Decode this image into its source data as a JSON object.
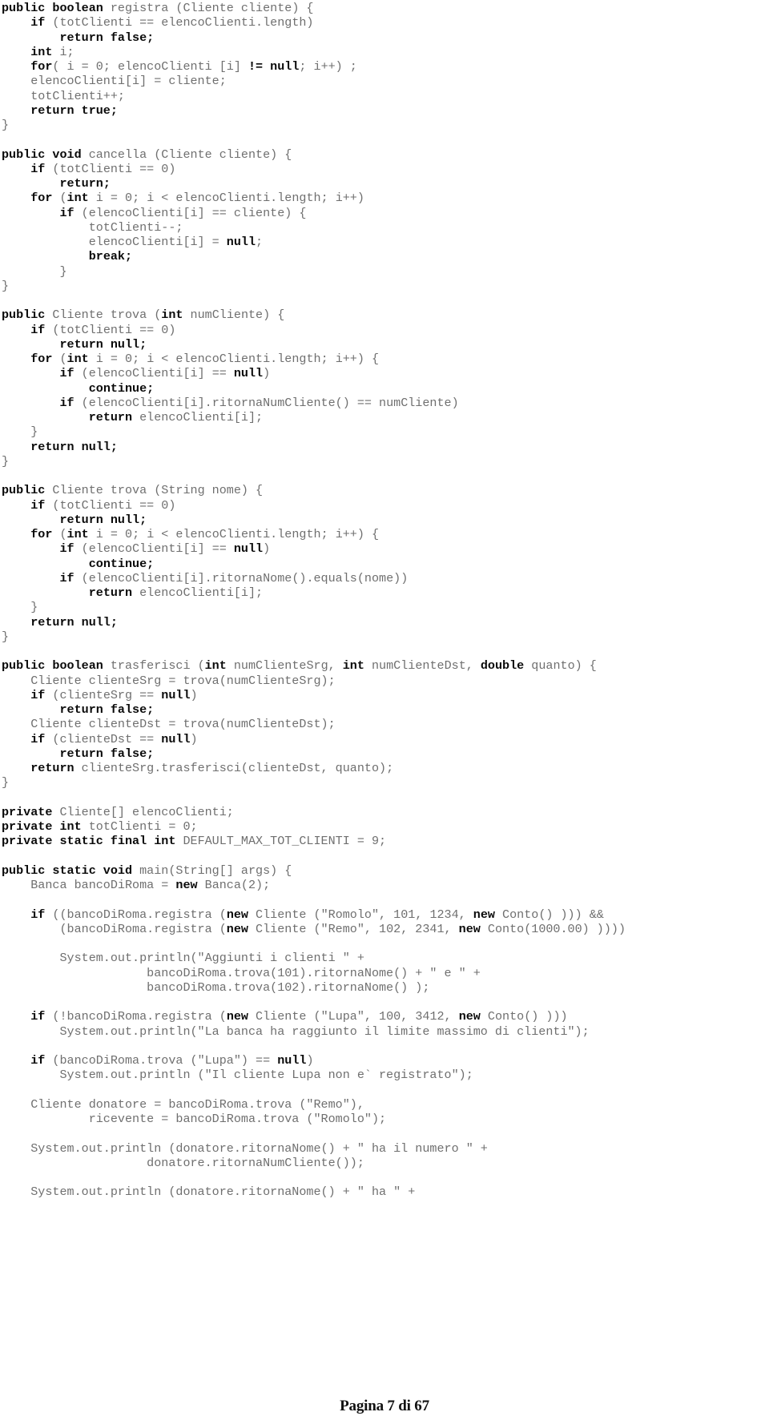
{
  "document": {
    "type": "source-code-listing",
    "language": "Java",
    "footer": {
      "label": "Pagina 7 di 67",
      "page_number": "7",
      "total_pages": "67"
    },
    "colors": {
      "keyword": "#0a0a0a",
      "identifier": "#6f6f6f",
      "background": "#ffffff",
      "footer": "#111111"
    }
  },
  "code": {
    "lines": [
      [
        {
          "t": "public boolean",
          "k": true
        },
        {
          "t": " registra (Cliente cliente) {",
          "k": false
        }
      ],
      [
        {
          "t": "    ",
          "k": false
        },
        {
          "t": "if",
          "k": true
        },
        {
          "t": " (totClienti == elencoClienti.length)",
          "k": false
        }
      ],
      [
        {
          "t": "        ",
          "k": false
        },
        {
          "t": "return false;",
          "k": true
        }
      ],
      [
        {
          "t": "    ",
          "k": false
        },
        {
          "t": "int",
          "k": true
        },
        {
          "t": " i;",
          "k": false
        }
      ],
      [
        {
          "t": "    ",
          "k": false
        },
        {
          "t": "for",
          "k": true
        },
        {
          "t": "( i = 0; elencoClienti [i] ",
          "k": false
        },
        {
          "t": "!= null",
          "k": true
        },
        {
          "t": "; i++) ;",
          "k": false
        }
      ],
      [
        {
          "t": "    elencoClienti[i] = cliente;",
          "k": false
        }
      ],
      [
        {
          "t": "    totClienti++;",
          "k": false
        }
      ],
      [
        {
          "t": "    ",
          "k": false
        },
        {
          "t": "return true;",
          "k": true
        }
      ],
      [
        {
          "t": "}",
          "k": false
        }
      ],
      [
        {
          "t": "",
          "k": false
        }
      ],
      [
        {
          "t": "public void",
          "k": true
        },
        {
          "t": " cancella (Cliente cliente) {",
          "k": false
        }
      ],
      [
        {
          "t": "    ",
          "k": false
        },
        {
          "t": "if",
          "k": true
        },
        {
          "t": " (totClienti == 0)",
          "k": false
        }
      ],
      [
        {
          "t": "        ",
          "k": false
        },
        {
          "t": "return;",
          "k": true
        }
      ],
      [
        {
          "t": "    ",
          "k": false
        },
        {
          "t": "for",
          "k": true
        },
        {
          "t": " (",
          "k": false
        },
        {
          "t": "int",
          "k": true
        },
        {
          "t": " i = 0; i < elencoClienti.length; i++)",
          "k": false
        }
      ],
      [
        {
          "t": "        ",
          "k": false
        },
        {
          "t": "if",
          "k": true
        },
        {
          "t": " (elencoClienti[i] == cliente) {",
          "k": false
        }
      ],
      [
        {
          "t": "            totClienti--;",
          "k": false
        }
      ],
      [
        {
          "t": "            elencoClienti[i] = ",
          "k": false
        },
        {
          "t": "null",
          "k": true
        },
        {
          "t": ";",
          "k": false
        }
      ],
      [
        {
          "t": "            ",
          "k": false
        },
        {
          "t": "break;",
          "k": true
        }
      ],
      [
        {
          "t": "        }",
          "k": false
        }
      ],
      [
        {
          "t": "}",
          "k": false
        }
      ],
      [
        {
          "t": "",
          "k": false
        }
      ],
      [
        {
          "t": "public",
          "k": true
        },
        {
          "t": " Cliente trova (",
          "k": false
        },
        {
          "t": "int",
          "k": true
        },
        {
          "t": " numCliente) {",
          "k": false
        }
      ],
      [
        {
          "t": "    ",
          "k": false
        },
        {
          "t": "if",
          "k": true
        },
        {
          "t": " (totClienti == 0)",
          "k": false
        }
      ],
      [
        {
          "t": "        ",
          "k": false
        },
        {
          "t": "return null;",
          "k": true
        }
      ],
      [
        {
          "t": "    ",
          "k": false
        },
        {
          "t": "for",
          "k": true
        },
        {
          "t": " (",
          "k": false
        },
        {
          "t": "int",
          "k": true
        },
        {
          "t": " i = 0; i < elencoClienti.length; i++) {",
          "k": false
        }
      ],
      [
        {
          "t": "        ",
          "k": false
        },
        {
          "t": "if",
          "k": true
        },
        {
          "t": " (elencoClienti[i] == ",
          "k": false
        },
        {
          "t": "null",
          "k": true
        },
        {
          "t": ")",
          "k": false
        }
      ],
      [
        {
          "t": "            ",
          "k": false
        },
        {
          "t": "continue;",
          "k": true
        }
      ],
      [
        {
          "t": "        ",
          "k": false
        },
        {
          "t": "if",
          "k": true
        },
        {
          "t": " (elencoClienti[i].ritornaNumCliente() == numCliente)",
          "k": false
        }
      ],
      [
        {
          "t": "            ",
          "k": false
        },
        {
          "t": "return",
          "k": true
        },
        {
          "t": " elencoClienti[i];",
          "k": false
        }
      ],
      [
        {
          "t": "    }",
          "k": false
        }
      ],
      [
        {
          "t": "    ",
          "k": false
        },
        {
          "t": "return null;",
          "k": true
        }
      ],
      [
        {
          "t": "}",
          "k": false
        }
      ],
      [
        {
          "t": "",
          "k": false
        }
      ],
      [
        {
          "t": "public",
          "k": true
        },
        {
          "t": " Cliente trova (String nome) {",
          "k": false
        }
      ],
      [
        {
          "t": "    ",
          "k": false
        },
        {
          "t": "if",
          "k": true
        },
        {
          "t": " (totClienti == 0)",
          "k": false
        }
      ],
      [
        {
          "t": "        ",
          "k": false
        },
        {
          "t": "return null;",
          "k": true
        }
      ],
      [
        {
          "t": "    ",
          "k": false
        },
        {
          "t": "for",
          "k": true
        },
        {
          "t": " (",
          "k": false
        },
        {
          "t": "int",
          "k": true
        },
        {
          "t": " i = 0; i < elencoClienti.length; i++) {",
          "k": false
        }
      ],
      [
        {
          "t": "        ",
          "k": false
        },
        {
          "t": "if",
          "k": true
        },
        {
          "t": " (elencoClienti[i] == ",
          "k": false
        },
        {
          "t": "null",
          "k": true
        },
        {
          "t": ")",
          "k": false
        }
      ],
      [
        {
          "t": "            ",
          "k": false
        },
        {
          "t": "continue;",
          "k": true
        }
      ],
      [
        {
          "t": "        ",
          "k": false
        },
        {
          "t": "if",
          "k": true
        },
        {
          "t": " (elencoClienti[i].ritornaNome().equals(nome))",
          "k": false
        }
      ],
      [
        {
          "t": "            ",
          "k": false
        },
        {
          "t": "return",
          "k": true
        },
        {
          "t": " elencoClienti[i];",
          "k": false
        }
      ],
      [
        {
          "t": "    }",
          "k": false
        }
      ],
      [
        {
          "t": "    ",
          "k": false
        },
        {
          "t": "return null;",
          "k": true
        }
      ],
      [
        {
          "t": "}",
          "k": false
        }
      ],
      [
        {
          "t": "",
          "k": false
        }
      ],
      [
        {
          "t": "public boolean",
          "k": true
        },
        {
          "t": " trasferisci (",
          "k": false
        },
        {
          "t": "int",
          "k": true
        },
        {
          "t": " numClienteSrg, ",
          "k": false
        },
        {
          "t": "int",
          "k": true
        },
        {
          "t": " numClienteDst, ",
          "k": false
        },
        {
          "t": "double",
          "k": true
        },
        {
          "t": " quanto) {",
          "k": false
        }
      ],
      [
        {
          "t": "    Cliente clienteSrg = trova(numClienteSrg);",
          "k": false
        }
      ],
      [
        {
          "t": "    ",
          "k": false
        },
        {
          "t": "if",
          "k": true
        },
        {
          "t": " (clienteSrg == ",
          "k": false
        },
        {
          "t": "null",
          "k": true
        },
        {
          "t": ")",
          "k": false
        }
      ],
      [
        {
          "t": "        ",
          "k": false
        },
        {
          "t": "return false;",
          "k": true
        }
      ],
      [
        {
          "t": "    Cliente clienteDst = trova(numClienteDst);",
          "k": false
        }
      ],
      [
        {
          "t": "    ",
          "k": false
        },
        {
          "t": "if",
          "k": true
        },
        {
          "t": " (clienteDst == ",
          "k": false
        },
        {
          "t": "null",
          "k": true
        },
        {
          "t": ")",
          "k": false
        }
      ],
      [
        {
          "t": "        ",
          "k": false
        },
        {
          "t": "return false;",
          "k": true
        }
      ],
      [
        {
          "t": "    ",
          "k": false
        },
        {
          "t": "return",
          "k": true
        },
        {
          "t": " clienteSrg.trasferisci(clienteDst, quanto);",
          "k": false
        }
      ],
      [
        {
          "t": "}",
          "k": false
        }
      ],
      [
        {
          "t": "",
          "k": false
        }
      ],
      [
        {
          "t": "private",
          "k": true
        },
        {
          "t": " Cliente[] elencoClienti;",
          "k": false
        }
      ],
      [
        {
          "t": "private int",
          "k": true
        },
        {
          "t": " totClienti = 0;",
          "k": false
        }
      ],
      [
        {
          "t": "private static final int",
          "k": true
        },
        {
          "t": " DEFAULT_MAX_TOT_CLIENTI = 9;",
          "k": false
        }
      ],
      [
        {
          "t": "",
          "k": false
        }
      ],
      [
        {
          "t": "public static void",
          "k": true
        },
        {
          "t": " main(String[] args) {",
          "k": false
        }
      ],
      [
        {
          "t": "    Banca bancoDiRoma = ",
          "k": false
        },
        {
          "t": "new",
          "k": true
        },
        {
          "t": " Banca(2);",
          "k": false
        }
      ],
      [
        {
          "t": "",
          "k": false
        }
      ],
      [
        {
          "t": "    ",
          "k": false
        },
        {
          "t": "if",
          "k": true
        },
        {
          "t": " ((bancoDiRoma.registra (",
          "k": false
        },
        {
          "t": "new",
          "k": true
        },
        {
          "t": " Cliente (\"Romolo\", 101, 1234, ",
          "k": false
        },
        {
          "t": "new",
          "k": true
        },
        {
          "t": " Conto() ))) &&",
          "k": false
        }
      ],
      [
        {
          "t": "        (bancoDiRoma.registra (",
          "k": false
        },
        {
          "t": "new",
          "k": true
        },
        {
          "t": " Cliente (\"Remo\", 102, 2341, ",
          "k": false
        },
        {
          "t": "new",
          "k": true
        },
        {
          "t": " Conto(1000.00) ))))",
          "k": false
        }
      ],
      [
        {
          "t": "",
          "k": false
        }
      ],
      [
        {
          "t": "        System.out.println(\"Aggiunti i clienti \" +",
          "k": false
        }
      ],
      [
        {
          "t": "                    bancoDiRoma.trova(101).ritornaNome() + \" e \" +",
          "k": false
        }
      ],
      [
        {
          "t": "                    bancoDiRoma.trova(102).ritornaNome() );",
          "k": false
        }
      ],
      [
        {
          "t": "",
          "k": false
        }
      ],
      [
        {
          "t": "    ",
          "k": false
        },
        {
          "t": "if",
          "k": true
        },
        {
          "t": " (!bancoDiRoma.registra (",
          "k": false
        },
        {
          "t": "new",
          "k": true
        },
        {
          "t": " Cliente (\"Lupa\", 100, 3412, ",
          "k": false
        },
        {
          "t": "new",
          "k": true
        },
        {
          "t": " Conto() )))",
          "k": false
        }
      ],
      [
        {
          "t": "        System.out.println(\"La banca ha raggiunto il limite massimo di clienti\");",
          "k": false
        }
      ],
      [
        {
          "t": "",
          "k": false
        }
      ],
      [
        {
          "t": "    ",
          "k": false
        },
        {
          "t": "if",
          "k": true
        },
        {
          "t": " (bancoDiRoma.trova (\"Lupa\") == ",
          "k": false
        },
        {
          "t": "null",
          "k": true
        },
        {
          "t": ")",
          "k": false
        }
      ],
      [
        {
          "t": "        System.out.println (\"Il cliente Lupa non e` registrato\");",
          "k": false
        }
      ],
      [
        {
          "t": "",
          "k": false
        }
      ],
      [
        {
          "t": "    Cliente donatore = bancoDiRoma.trova (\"Remo\"),",
          "k": false
        }
      ],
      [
        {
          "t": "            ricevente = bancoDiRoma.trova (\"Romolo\");",
          "k": false
        }
      ],
      [
        {
          "t": "",
          "k": false
        }
      ],
      [
        {
          "t": "    System.out.println (donatore.ritornaNome() + \" ha il numero \" +",
          "k": false
        }
      ],
      [
        {
          "t": "                    donatore.ritornaNumCliente());",
          "k": false
        }
      ],
      [
        {
          "t": "",
          "k": false
        }
      ],
      [
        {
          "t": "    System.out.println (donatore.ritornaNome() + \" ha \" +",
          "k": false
        }
      ]
    ]
  }
}
